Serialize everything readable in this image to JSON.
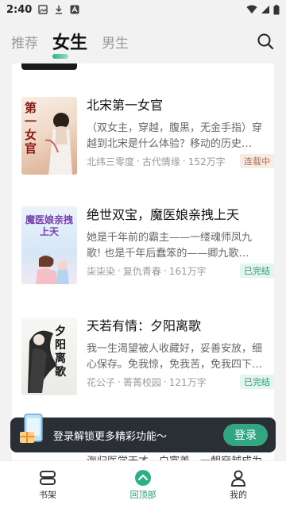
{
  "status_bar": {
    "time": "2:40"
  },
  "top_nav": {
    "tabs": [
      {
        "label": "推荐",
        "active": false
      },
      {
        "label": "女生",
        "active": true
      },
      {
        "label": "男生",
        "active": false
      }
    ],
    "search_icon": "search-icon"
  },
  "books": [
    {
      "title": "北宋第一女官",
      "desc": "（双女主，穿越，腹黑，无金手指）穿越到北宋是什么体验？移动的历史…",
      "author": "北纬三零度",
      "category": "古代情缘",
      "words": "152万字",
      "status": "连载中",
      "cover_text": "第一女官"
    },
    {
      "title": "绝世双宝，魔医娘亲拽上天",
      "desc": "她是千年前的霸主——一缕魂师凤九歌! 也是千年后蠢笨的——卿九歌…",
      "author": "柒柒染",
      "category": "复仇青春",
      "words": "161万字",
      "status": "已完结",
      "cover_text": "魔医娘亲拽上天"
    },
    {
      "title": "天若有情：夕阳离歌",
      "desc": "我一生渴望被人收藏好，妥善安放，细心保存。免我惊，免我苦，免我四下…",
      "author": "花公子",
      "category": "菁菁校园",
      "words": "121万字",
      "status": "已完结",
      "cover_text": "夕阳离歌"
    }
  ],
  "next_book_peek": "海归医学天才，白富美，一朝穿越成为",
  "login_banner": {
    "text": "登录解锁更多精彩功能～",
    "button": "登录"
  },
  "bottom_nav": [
    {
      "label": "书架",
      "icon": "bookshelf-icon",
      "active": false
    },
    {
      "label": "回顶部",
      "icon": "back-to-top-icon",
      "active": true
    },
    {
      "label": "我的",
      "icon": "profile-icon",
      "active": false
    }
  ]
}
